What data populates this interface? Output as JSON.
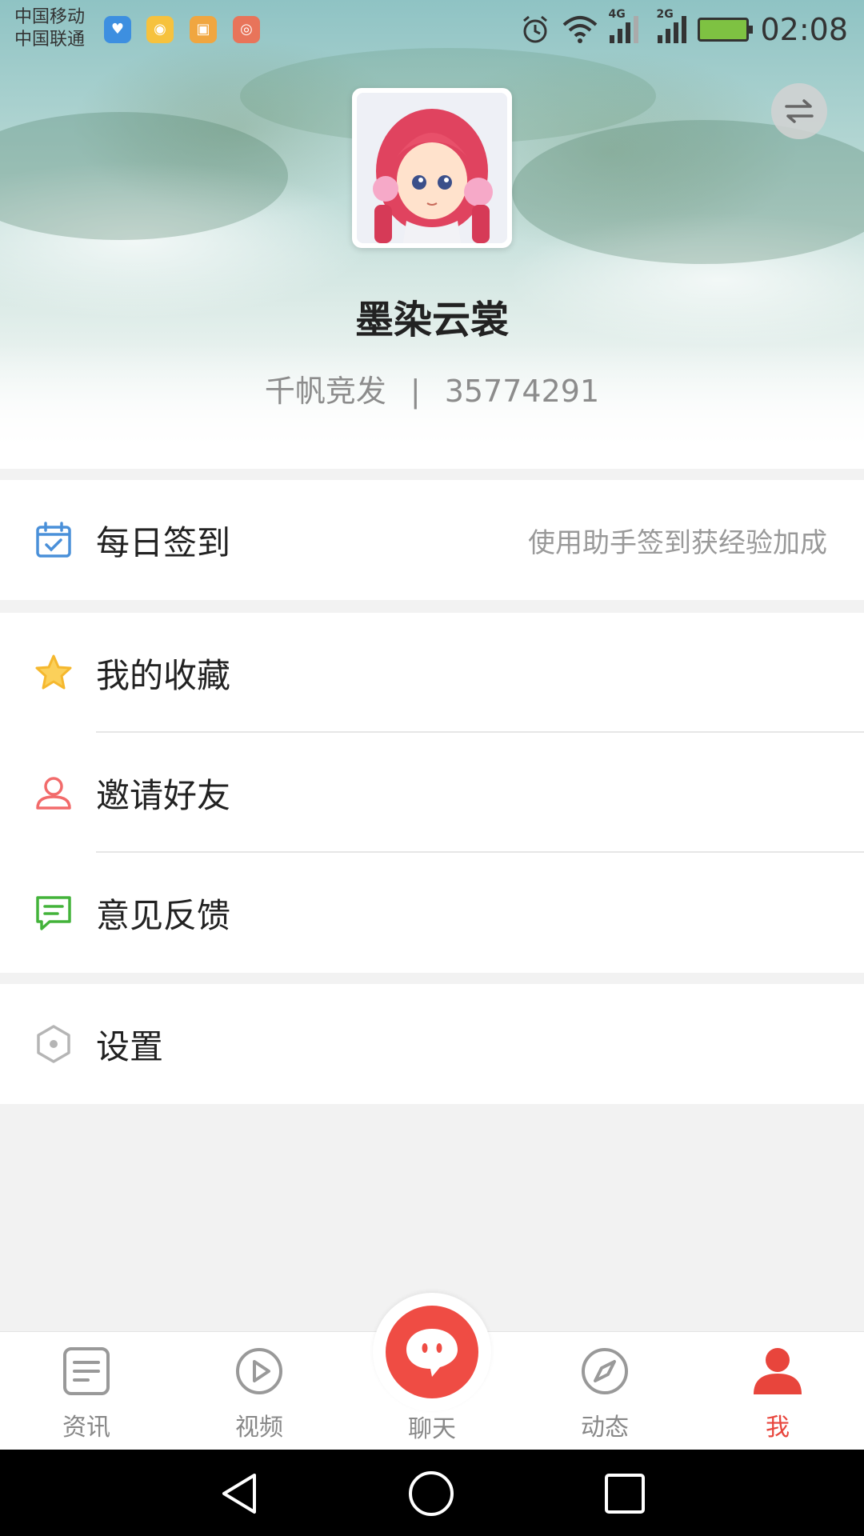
{
  "status_bar": {
    "carrier_1": "中国移动",
    "carrier_2": "中国联通",
    "network_1": "4G",
    "network_2": "2G",
    "time": "02:08",
    "notification_icons": [
      "health-app-icon",
      "weibo-icon",
      "orange-app-icon",
      "red-app-icon"
    ]
  },
  "profile": {
    "username": "墨染云裳",
    "server": "千帆竞发",
    "separator": "|",
    "user_id": "35774291"
  },
  "menu": {
    "checkin": {
      "label": "每日签到",
      "hint": "使用助手签到获经验加成",
      "icon": "calendar-check-icon",
      "color": "#4a90d9"
    },
    "favorites": {
      "label": "我的收藏",
      "icon": "star-icon",
      "color": "#f5b82e"
    },
    "invite": {
      "label": "邀请好友",
      "icon": "user-icon",
      "color": "#f26b6b"
    },
    "feedback": {
      "label": "意见反馈",
      "icon": "message-icon",
      "color": "#43b33a"
    },
    "settings": {
      "label": "设置",
      "icon": "hexagon-settings-icon",
      "color": "#b5b5b5"
    }
  },
  "bottom_nav": {
    "news": "资讯",
    "video": "视频",
    "chat": "聊天",
    "moments": "动态",
    "me": "我",
    "active": "me",
    "accent": "#e8453c"
  }
}
